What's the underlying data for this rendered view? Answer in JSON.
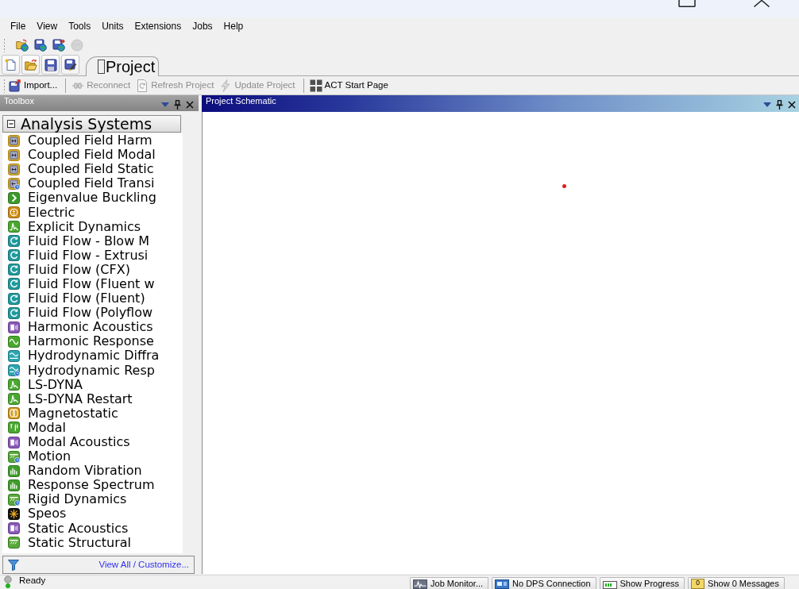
{
  "menu": [
    "File",
    "View",
    "Tools",
    "Units",
    "Extensions",
    "Jobs",
    "Help"
  ],
  "quick_toolbar": [
    {
      "kind": "web-open",
      "disabled": false
    },
    {
      "kind": "web-save",
      "disabled": false
    },
    {
      "kind": "web-export",
      "disabled": false
    },
    {
      "kind": "web-status",
      "disabled": true
    }
  ],
  "tabs": [
    {
      "label": "Project",
      "selected": true
    }
  ],
  "toolbar_groups": [
    {
      "buttons": [
        {
          "label": "Import...",
          "kind": "import",
          "disabled": false
        }
      ]
    },
    {
      "buttons": [
        {
          "label": "Reconnect",
          "kind": "reconnect",
          "disabled": true
        },
        {
          "label": "Refresh Project",
          "kind": "refresh",
          "disabled": true
        },
        {
          "label": "Update Project",
          "kind": "update",
          "disabled": true
        }
      ]
    },
    {
      "buttons": [
        {
          "label": "ACT Start Page",
          "kind": "act",
          "disabled": false
        }
      ]
    }
  ],
  "toolbox": {
    "title": "Toolbox",
    "section": {
      "label": "Analysis Systems",
      "expanded": true,
      "items": [
        {
          "label": "Coupled Field Harm",
          "kind": "coupled"
        },
        {
          "label": "Coupled Field Modal",
          "kind": "coupled"
        },
        {
          "label": "Coupled Field Static",
          "kind": "coupled"
        },
        {
          "label": "Coupled Field Transi",
          "kind": "coupled-transient"
        },
        {
          "label": "Eigenvalue Buckling",
          "kind": "buckling"
        },
        {
          "label": "Electric",
          "kind": "electric"
        },
        {
          "label": "Explicit Dynamics",
          "kind": "explicit"
        },
        {
          "label": "Fluid Flow - Blow M",
          "kind": "fluid"
        },
        {
          "label": "Fluid Flow - Extrusi",
          "kind": "fluid"
        },
        {
          "label": "Fluid Flow (CFX)",
          "kind": "fluid"
        },
        {
          "label": "Fluid Flow (Fluent w",
          "kind": "fluid"
        },
        {
          "label": "Fluid Flow (Fluent)",
          "kind": "fluid"
        },
        {
          "label": "Fluid Flow (Polyflow",
          "kind": "fluid"
        },
        {
          "label": "Harmonic Acoustics",
          "kind": "acoustic"
        },
        {
          "label": "Harmonic Response",
          "kind": "harmonic"
        },
        {
          "label": "Hydrodynamic Diffra",
          "kind": "hydro"
        },
        {
          "label": "Hydrodynamic Resp",
          "kind": "hydro-transient"
        },
        {
          "label": "LS-DYNA",
          "kind": "explicit"
        },
        {
          "label": "LS-DYNA Restart",
          "kind": "explicit"
        },
        {
          "label": "Magnetostatic",
          "kind": "magnetic"
        },
        {
          "label": "Modal",
          "kind": "modal"
        },
        {
          "label": "Modal Acoustics",
          "kind": "acoustic"
        },
        {
          "label": "Motion",
          "kind": "motion"
        },
        {
          "label": "Random Vibration",
          "kind": "spectrum"
        },
        {
          "label": "Response Spectrum",
          "kind": "spectrum"
        },
        {
          "label": "Rigid Dynamics",
          "kind": "motion"
        },
        {
          "label": "Speos",
          "kind": "optical"
        },
        {
          "label": "Static Acoustics",
          "kind": "acoustic"
        },
        {
          "label": "Static Structural",
          "kind": "static"
        }
      ]
    },
    "footer_link": "View All / Customize..."
  },
  "schematic": {
    "title": "Project Schematic"
  },
  "status_bar": {
    "text": "Ready",
    "panels": [
      {
        "label": "Job Monitor...",
        "kind": "job"
      },
      {
        "label": "No DPS Connection",
        "kind": "dps"
      },
      {
        "label": "Show Progress",
        "kind": "progress"
      },
      {
        "label": "Show 0 Messages",
        "kind": "messages",
        "count": "0"
      }
    ]
  }
}
